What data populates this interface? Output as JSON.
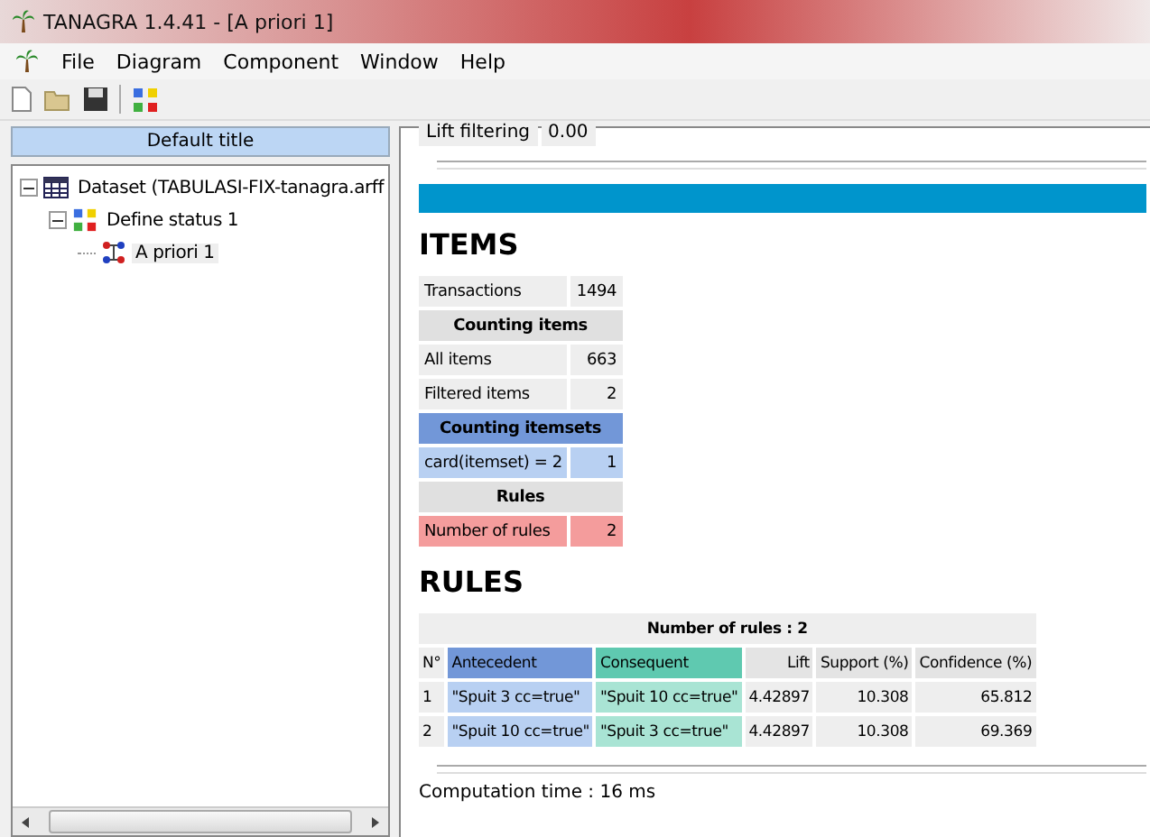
{
  "window": {
    "title": "TANAGRA 1.4.41 - [A priori 1]"
  },
  "menu": [
    "File",
    "Diagram",
    "Component",
    "Window",
    "Help"
  ],
  "toolbar": [
    {
      "kind": "new"
    },
    {
      "kind": "open"
    },
    {
      "kind": "save"
    },
    {
      "kind": "separator"
    },
    {
      "kind": "diagram"
    }
  ],
  "sidebar": {
    "title": "Default title",
    "tree": [
      {
        "label": "Dataset (TABULASI-FIX-tanagra.arff",
        "kind": "dataset",
        "expanded": true,
        "children": [
          {
            "label": "Define status 1",
            "kind": "status",
            "expanded": true,
            "children": [
              {
                "label": "A priori 1",
                "kind": "apriori",
                "selected": true
              }
            ]
          }
        ]
      }
    ]
  },
  "report": {
    "filter": {
      "label": "Lift filtering",
      "value": "0.00"
    },
    "items_heading": "ITEMS",
    "items_rows": [
      {
        "kind": "row",
        "label": "Transactions",
        "value": "1494"
      },
      {
        "kind": "heading",
        "label": "Counting items"
      },
      {
        "kind": "row",
        "label": "All items",
        "value": "663"
      },
      {
        "kind": "row",
        "label": "Filtered items",
        "value": "2"
      },
      {
        "kind": "blue-heading",
        "label": "Counting itemsets"
      },
      {
        "kind": "blue-row",
        "label": "card(itemset) = 2",
        "value": "1"
      },
      {
        "kind": "heading",
        "label": "Rules"
      },
      {
        "kind": "red-row",
        "label": "Number of rules",
        "value": "2"
      }
    ],
    "rules_heading": "RULES",
    "rules_caption": "Number of rules : 2",
    "rules_columns": [
      {
        "label": "N°",
        "kind": "index"
      },
      {
        "label": "Antecedent",
        "kind": "antecedent"
      },
      {
        "label": "Consequent",
        "kind": "consequent"
      },
      {
        "label": "Lift",
        "kind": "number"
      },
      {
        "label": "Support (%)",
        "kind": "number"
      },
      {
        "label": "Confidence (%)",
        "kind": "number"
      }
    ],
    "rules_rows": [
      [
        "1",
        "\"Spuit 3 cc=true\"",
        "\"Spuit 10 cc=true\"",
        "4.42897",
        "10.308",
        "65.812"
      ],
      [
        "2",
        "\"Spuit 10 cc=true\"",
        "\"Spuit 3 cc=true\"",
        "4.42897",
        "10.308",
        "69.369"
      ]
    ],
    "footer": "Computation time : 16 ms"
  }
}
